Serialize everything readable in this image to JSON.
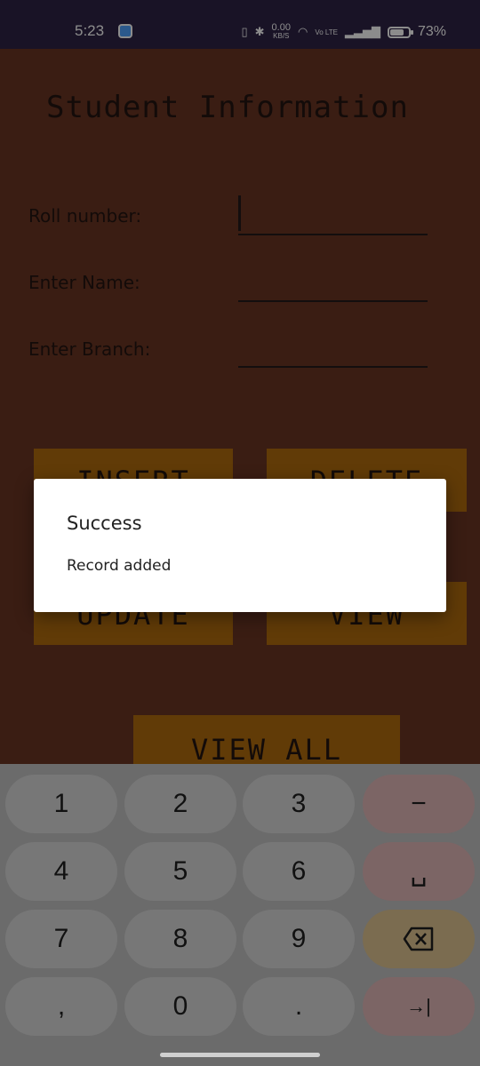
{
  "status": {
    "time": "5:23",
    "net_speed_value": "0.00",
    "net_speed_unit": "KB/S",
    "volte": "Vo LTE",
    "battery": "73%"
  },
  "app": {
    "title": "Student Information",
    "roll_label": "Roll number:",
    "name_label": "Enter Name:",
    "branch_label": "Enter Branch:",
    "insert_label": "INSERT",
    "delete_label": "DELETE",
    "update_label": "UPDATE",
    "view_label": "VIEW",
    "view_all_label": "VIEW ALL"
  },
  "dialog": {
    "title": "Success",
    "message": "Record added"
  },
  "keyboard": {
    "rows": [
      [
        "1",
        "2",
        "3",
        "−"
      ],
      [
        "4",
        "5",
        "6",
        "space"
      ],
      [
        "7",
        "8",
        "9",
        "backspace"
      ],
      [
        ",",
        "0",
        ".",
        "enter"
      ]
    ],
    "k1": "1",
    "k2": "2",
    "k3": "3",
    "k4": "4",
    "k5": "5",
    "k6": "6",
    "k7": "7",
    "k8": "8",
    "k9": "9",
    "k0": "0",
    "comma": ",",
    "dot": ".",
    "minus": "−",
    "space_glyph": "␣",
    "enter_glyph": "→|"
  },
  "colors": {
    "app_bg": "#6a3523",
    "button": "#b16c0d",
    "status_bar": "#2e2346"
  }
}
